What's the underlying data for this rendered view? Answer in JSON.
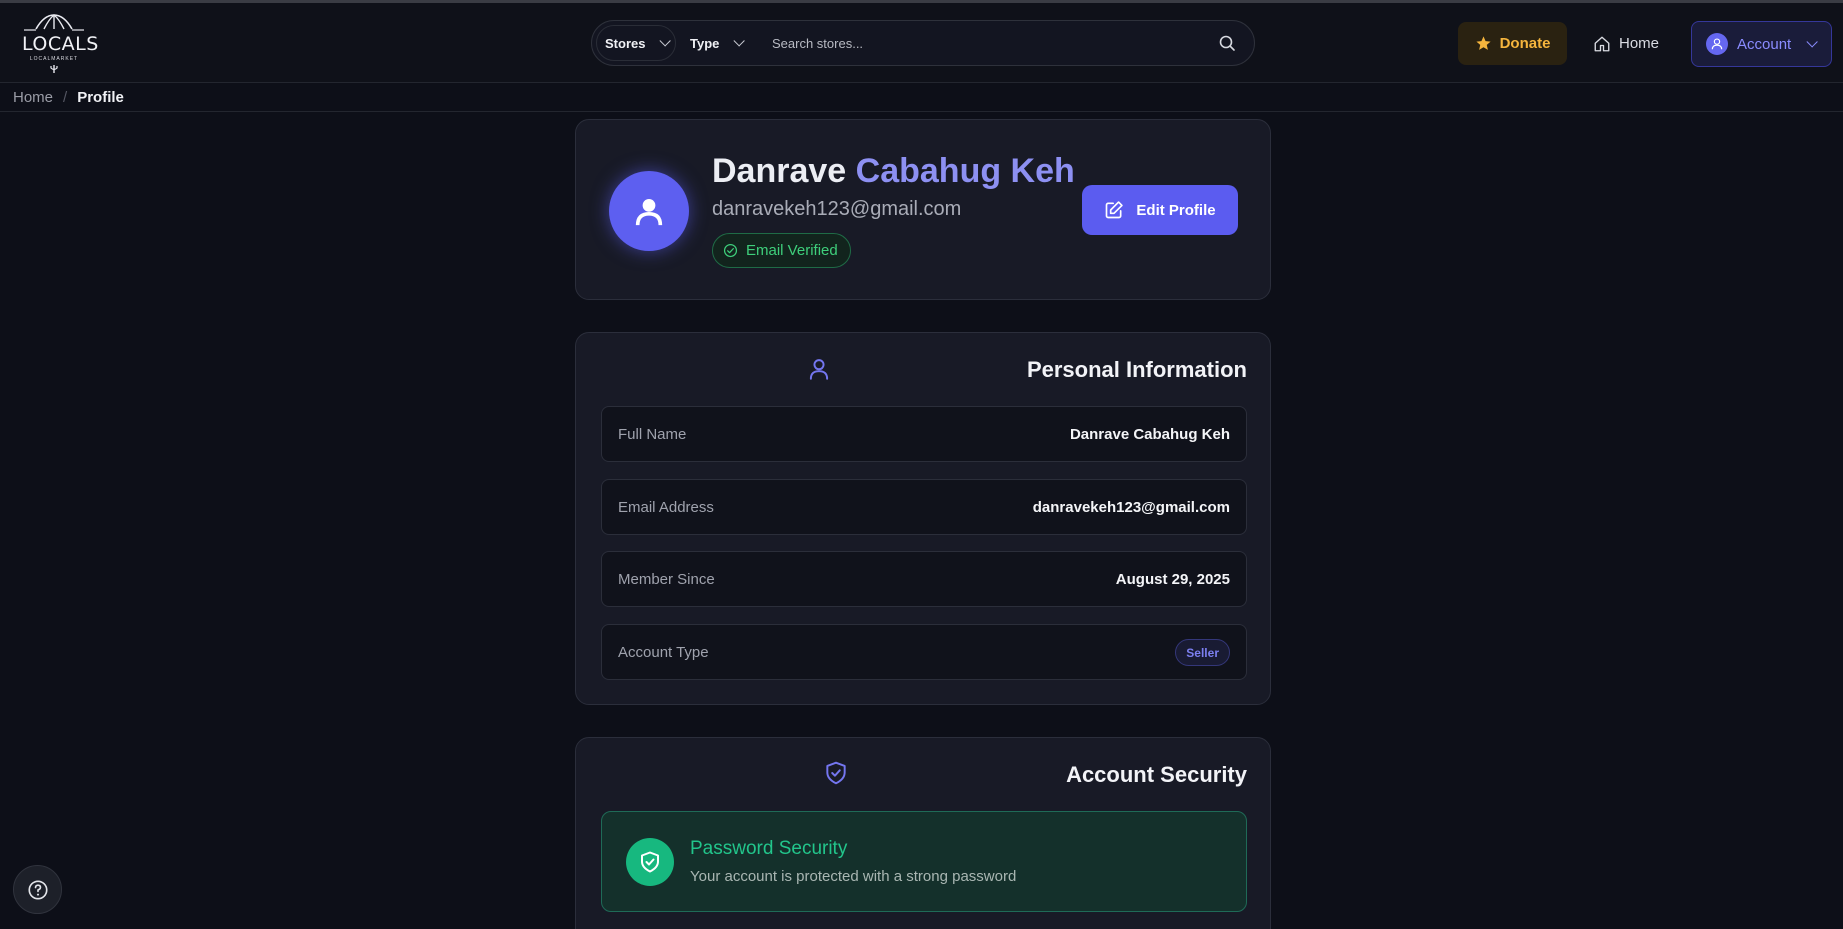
{
  "header": {
    "logo": {
      "text": "LOCALS",
      "subtext": "LOCALMARKET"
    },
    "search": {
      "stores_select": "Stores",
      "type_select": "Type",
      "placeholder": "Search stores..."
    },
    "donate_label": "Donate",
    "home_label": "Home",
    "account_label": "Account"
  },
  "breadcrumb": {
    "home": "Home",
    "separator": "/",
    "current": "Profile"
  },
  "profile": {
    "first_name": "Danrave",
    "last_name": "Cabahug Keh",
    "email": "danravekeh123@gmail.com",
    "verified_label": "Email Verified",
    "edit_label": "Edit Profile"
  },
  "personal_info": {
    "title": "Personal Information",
    "rows": [
      {
        "label": "Full Name",
        "value": "Danrave Cabahug Keh"
      },
      {
        "label": "Email Address",
        "value": "danravekeh123@gmail.com"
      },
      {
        "label": "Member Since",
        "value": "August 29, 2025"
      },
      {
        "label": "Account Type",
        "value": "Seller"
      }
    ]
  },
  "security": {
    "title": "Account Security",
    "password_title": "Password Security",
    "password_desc": "Your account is protected with a strong password"
  },
  "icons": {
    "search": "search-icon",
    "donate": "star-icon",
    "home": "home-icon",
    "account": "user-icon",
    "edit": "edit-icon",
    "verified": "check-circle-icon",
    "security": "shield-check-icon",
    "help": "help-circle-icon"
  },
  "colors": {
    "accent": "#5b5cf0",
    "success": "#22c58b",
    "donate": "#f5b53d",
    "background": "#0d0f18"
  }
}
